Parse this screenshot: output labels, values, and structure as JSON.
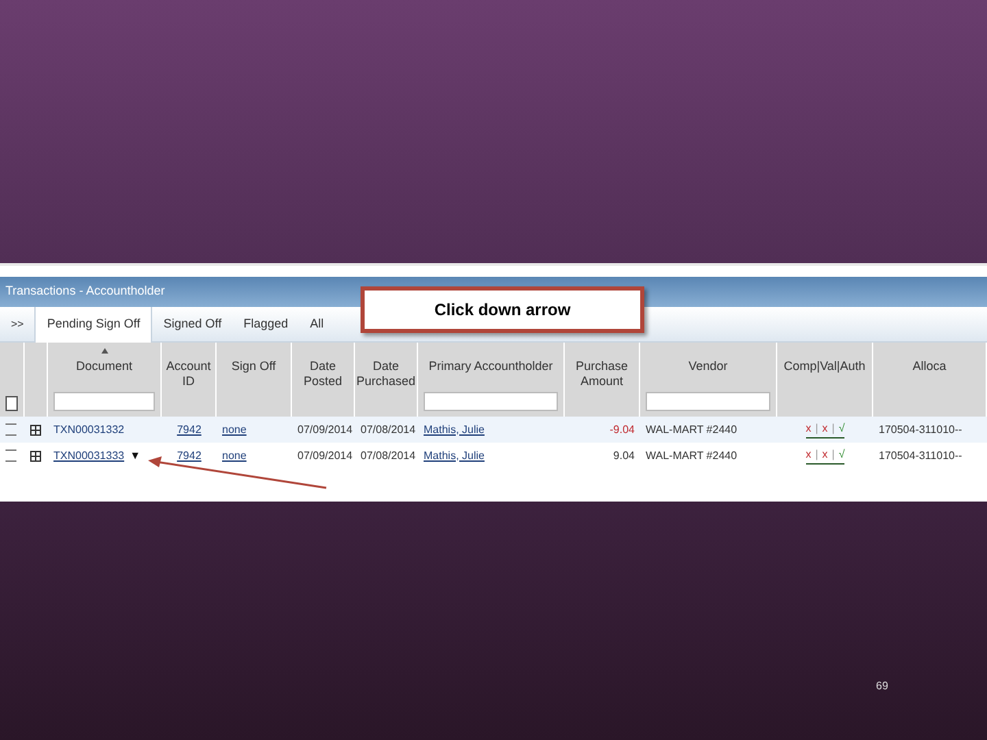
{
  "window": {
    "title": "Transactions - Accountholder"
  },
  "expand_toggle": ">>",
  "tabs": [
    {
      "label": "Pending Sign Off",
      "selected": true
    },
    {
      "label": "Signed Off",
      "selected": false
    },
    {
      "label": "Flagged",
      "selected": false
    },
    {
      "label": "All",
      "selected": false
    }
  ],
  "callout": {
    "text": "Click down arrow"
  },
  "table": {
    "select_all": {
      "checked": false
    },
    "columns": [
      {
        "label": "Document",
        "sorted": true,
        "filter": true
      },
      {
        "label": "Account ID",
        "sorted": false,
        "filter": false
      },
      {
        "label": "Sign Off",
        "sorted": false,
        "filter": false
      },
      {
        "label": "Date Posted",
        "sorted": false,
        "filter": false
      },
      {
        "label": "Date Purchased",
        "sorted": false,
        "filter": false
      },
      {
        "label": "Primary Accountholder",
        "sorted": false,
        "filter": true
      },
      {
        "label": "Purchase Amount",
        "sorted": false,
        "filter": false
      },
      {
        "label": "Vendor",
        "sorted": false,
        "filter": true
      },
      {
        "label": "Comp|Val|Auth",
        "sorted": false,
        "filter": false
      },
      {
        "label": "Alloca",
        "sorted": false,
        "filter": false
      }
    ],
    "rows": [
      {
        "document": "TXN00031332",
        "hovered": false,
        "account_id": "7942",
        "sign_off": "none",
        "date_posted": "07/09/2014",
        "date_purchased": "07/08/2014",
        "accountholder": "Mathis, Julie",
        "amount": "-9.04",
        "negative": true,
        "vendor": "WAL-MART #2440",
        "separator": "|",
        "checks": [
          {
            "mark": "x",
            "passed": false
          },
          {
            "mark": "x",
            "passed": false
          },
          {
            "mark": "√",
            "passed": true
          }
        ],
        "allocation": "170504-311010--",
        "checked": false
      },
      {
        "document": "TXN00031333",
        "hovered": true,
        "dropdown": "▼",
        "account_id": "7942",
        "sign_off": "none",
        "date_posted": "07/09/2014",
        "date_purchased": "07/08/2014",
        "accountholder": "Mathis, Julie",
        "amount": "9.04",
        "negative": false,
        "vendor": "WAL-MART #2440",
        "separator": "|",
        "checks": [
          {
            "mark": "x",
            "passed": false
          },
          {
            "mark": "x",
            "passed": false
          },
          {
            "mark": "√",
            "passed": true
          }
        ],
        "allocation": "170504-311010--",
        "checked": false
      }
    ]
  },
  "page_number": "69"
}
